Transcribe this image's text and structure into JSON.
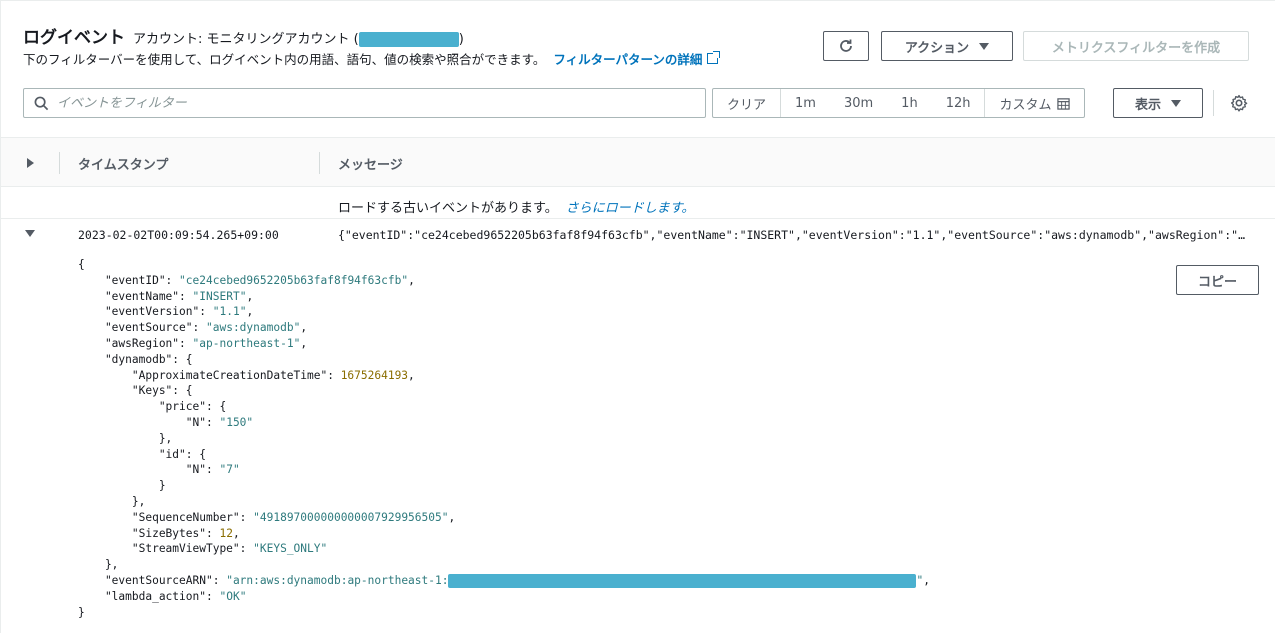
{
  "header": {
    "title": "ログイベント",
    "account_prefix": "アカウント: モニタリングアカウント (",
    "account_suffix": ")",
    "description": "下のフィルターバーを使用して、ログイベント内の用語、語句、値の検索や照合ができます。",
    "filter_link": "フィルターパターンの詳細"
  },
  "toolbar": {
    "action_label": "アクション",
    "metric_filter_label": "メトリクスフィルターを作成"
  },
  "filter": {
    "placeholder": "イベントをフィルター",
    "clear_label": "クリア",
    "range_1m": "1m",
    "range_30m": "30m",
    "range_1h": "1h",
    "range_12h": "12h",
    "custom_label": "カスタム",
    "display_label": "表示"
  },
  "table": {
    "col_timestamp": "タイムスタンプ",
    "col_message": "メッセージ",
    "load_more_text": "ロードする古いイベントがあります。",
    "load_more_link": "さらにロードします。"
  },
  "event": {
    "timestamp": "2023-02-02T00:09:54.265+09:00",
    "message": "{\"eventID\":\"ce24cebed9652205b63faf8f94f63cfb\",\"eventName\":\"INSERT\",\"eventVersion\":\"1.1\",\"eventSource\":\"aws:dynamodb\",\"awsRegion\":\"ap-northeast-1\",\"dynamodb\":{\"ApproximateCreationDateTime\":1675264193,\"Keys\":{\"price\":{\"N\":\"150\"},\"id\":{\"N\":\"7\"}},\"SequenceNumber\":\"491897000000000007929956505\",\"SizeBytes\":12,\"StreamViewType\":\"KEYS_ONLY\"},\"eventSourceARN\":\"arn:aws:dynamodb:ap-northeast-1:\",\"lambda_action\":\"OK\"}",
    "copy_label": "コピー",
    "json": {
      "eventID": "ce24cebed9652205b63faf8f94f63cfb",
      "eventName": "INSERT",
      "eventVersion": "1.1",
      "eventSource": "aws:dynamodb",
      "awsRegion": "ap-northeast-1",
      "ApproximateCreationDateTime": "1675264193",
      "price_N": "150",
      "id_N": "7",
      "SequenceNumber": "491897000000000007929956505",
      "SizeBytes": "12",
      "StreamViewType": "KEYS_ONLY",
      "eventSourceARN_prefix": "arn:aws:dynamodb:ap-northeast-1:",
      "lambda_action": "OK"
    }
  },
  "colors": {
    "link": "#0073bb",
    "redaction": "#4ab0cf"
  },
  "icons": [
    "refresh-icon",
    "search-icon",
    "calendar-icon",
    "gear-icon",
    "external-link-icon",
    "expand-caret-icon"
  ]
}
